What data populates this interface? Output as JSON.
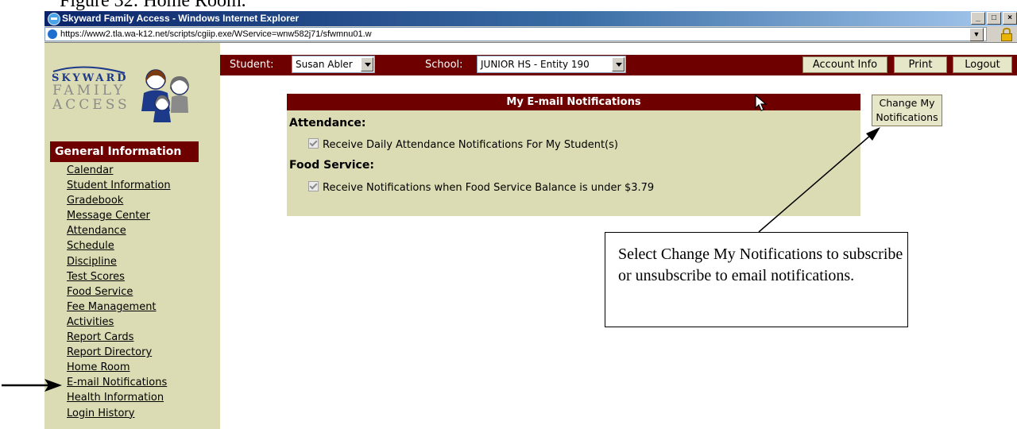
{
  "figure_caption": "Figure 32: Home Room.",
  "window": {
    "title": "Skyward Family Access - Windows Internet Explorer",
    "controls": [
      "_",
      "□",
      "×"
    ]
  },
  "address_bar": {
    "url": "https://www2.tla.wa-k12.net/scripts/cgiip.exe/WService=wnw582j71/sfwmnu01.w"
  },
  "toolbar": {
    "student_label": "Student:",
    "student_value": "Susan Abler",
    "school_label": "School:",
    "school_value": "JUNIOR HS - Entity 190",
    "account_info": "Account Info",
    "print": "Print",
    "logout": "Logout"
  },
  "logo": {
    "line1": "SKYWARD",
    "line2": "FAMILY",
    "line3": "ACCESS"
  },
  "sidebar": {
    "header": "General Information",
    "items": [
      "Calendar",
      "Student Information",
      "Gradebook",
      "Message Center",
      "Attendance",
      "Schedule",
      "Discipline",
      "Test Scores",
      "Food Service",
      "Fee Management",
      "Activities",
      "Report Cards",
      "Report Directory",
      "Home Room",
      "E-mail Notifications",
      "Health Information",
      "Login History"
    ]
  },
  "panel": {
    "title": "My E-mail Notifications",
    "attendance_title": "Attendance:",
    "attendance_option": "Receive Daily Attendance Notifications For My Student(s)",
    "food_title": "Food Service:",
    "food_option": "Receive Notifications when Food Service Balance is under $3.79"
  },
  "change_button": {
    "line1": "Change My",
    "line2": "Notifications"
  },
  "callout": {
    "text": "Select Change My Notifications to subscribe or unsubscribe to email notifications."
  },
  "colors": {
    "maroon": "#6e0000",
    "tan": "#dcdcb4",
    "button_bg": "#e6e6c8"
  }
}
